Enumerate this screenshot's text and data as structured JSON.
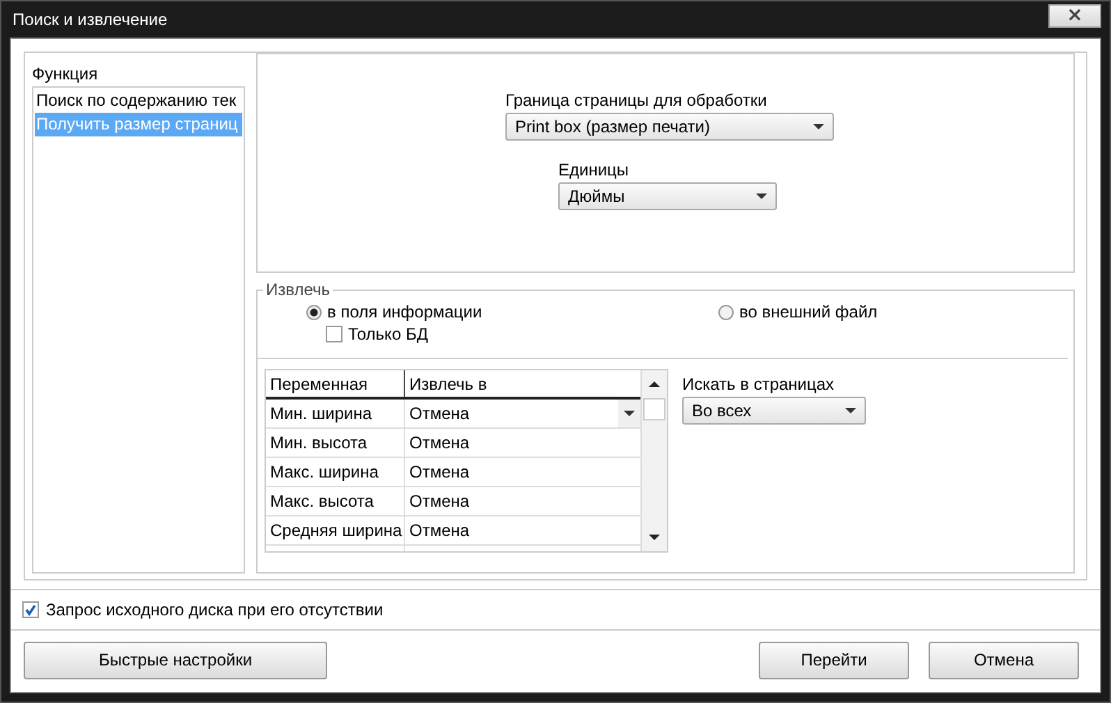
{
  "window": {
    "title": "Поиск и извлечение",
    "close": "×"
  },
  "function_list": {
    "label": "Функция",
    "items": [
      {
        "label": "Поиск по содержанию тек",
        "selected": false
      },
      {
        "label": "Получить размер страниц",
        "selected": true
      }
    ]
  },
  "page_bound": {
    "label": "Граница страницы для обработки",
    "value": "Print box (размер печати)"
  },
  "units": {
    "label": "Единицы",
    "value": "Дюймы"
  },
  "extract": {
    "legend": "Извлечь",
    "options": [
      {
        "label": "в поля информации",
        "selected": true
      },
      {
        "label": "во внешний файл",
        "selected": false
      }
    ],
    "db_only": {
      "label": "Только БД",
      "checked": false
    }
  },
  "table": {
    "columns": [
      "Переменная",
      "Извлечь в"
    ],
    "rows": [
      {
        "cells": [
          "Мин. ширина",
          "Отмена"
        ],
        "editing": true
      },
      {
        "cells": [
          "Мин. высота",
          "Отмена"
        ],
        "editing": false
      },
      {
        "cells": [
          "Макс. ширина",
          "Отмена"
        ],
        "editing": false
      },
      {
        "cells": [
          "Макс. высота",
          "Отмена"
        ],
        "editing": false
      },
      {
        "cells": [
          "Средняя ширина",
          "Отмена"
        ],
        "editing": false
      }
    ]
  },
  "search_pages": {
    "label": "Искать в страницах",
    "value": "Во всех"
  },
  "ask_disk": {
    "label": "Запрос исходного диска при его отсутствии",
    "checked": true
  },
  "buttons": [
    {
      "label": "Быстрые настройки",
      "kind": "left"
    },
    {
      "label": "Перейти",
      "kind": "right"
    },
    {
      "label": "Отмена",
      "kind": "right"
    }
  ]
}
